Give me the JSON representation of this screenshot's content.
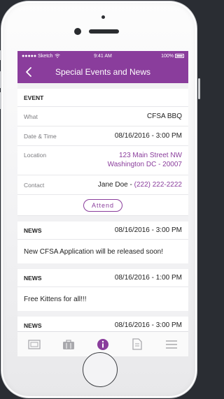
{
  "status": {
    "carrier": "Sketch",
    "time": "9:41 AM",
    "battery": "100%"
  },
  "header": {
    "title": "Special Events and News",
    "accent": "#8a3d9c"
  },
  "event": {
    "heading": "EVENT",
    "what": {
      "label": "What",
      "value": "CFSA BBQ"
    },
    "datetime": {
      "label": "Date & Time",
      "value": "08/16/2016 - 3:00 PM"
    },
    "location": {
      "label": "Location",
      "line1": "123 Main Street NW",
      "line2": "Washington DC - 20007"
    },
    "contact": {
      "label": "Contact",
      "name": "Jane Doe - ",
      "phone": "(222) 222-2222"
    },
    "attend_label": "Attend"
  },
  "news": [
    {
      "tag": "NEWS",
      "date": "08/16/2016 - 3:00 PM",
      "text": "New CFSA Application will be released soon!"
    },
    {
      "tag": "NEWS",
      "date": "08/16/2016 - 1:00 PM",
      "text": "Free Kittens for all!!!"
    },
    {
      "tag": "NEWS",
      "date": "08/16/2016 - 3:00 PM",
      "text": ""
    }
  ],
  "tabs": [
    {
      "icon": "photo-frame-icon"
    },
    {
      "icon": "briefcase-icon"
    },
    {
      "icon": "info-icon",
      "active": true
    },
    {
      "icon": "document-icon"
    },
    {
      "icon": "menu-icon"
    }
  ]
}
